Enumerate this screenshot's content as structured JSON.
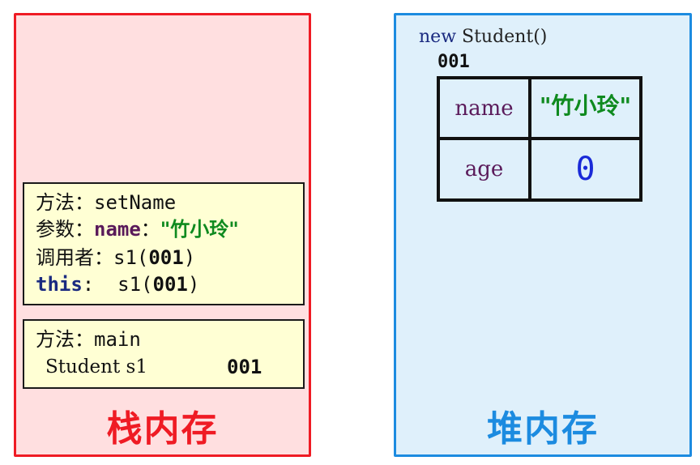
{
  "stack": {
    "title": "栈内存",
    "frame_setname": {
      "method_label": "方法：",
      "method_value": "setName",
      "param_label": "参数：",
      "param_name": "name",
      "param_sep": "：",
      "param_value": "\"竹小玲\"",
      "caller_label": "调用者：",
      "caller_value_prefix": "s1(",
      "caller_value_addr": "001",
      "caller_value_suffix": ")",
      "this_kw": "this",
      "this_sep": ":  ",
      "this_value_prefix": "s1(",
      "this_value_addr": "001",
      "this_value_suffix": ")"
    },
    "frame_main": {
      "method_label": "方法：",
      "method_value": "main",
      "var_decl": "Student s1",
      "var_value": "001"
    }
  },
  "heap": {
    "title": "堆内存",
    "new_kw": "new",
    "new_expr": " Student()",
    "address": "001",
    "fields": [
      {
        "name": "name",
        "value": "\"竹小玲\""
      },
      {
        "name": "age",
        "value": "0"
      }
    ]
  },
  "colors": {
    "stack_border": "#ef1b24",
    "stack_bg": "#ffdfe0",
    "heap_border": "#1c8be0",
    "heap_bg": "#dff0fb",
    "frame_bg": "#ffffd4",
    "string_green": "#0f8a1f",
    "number_blue": "#1a2ad8"
  }
}
